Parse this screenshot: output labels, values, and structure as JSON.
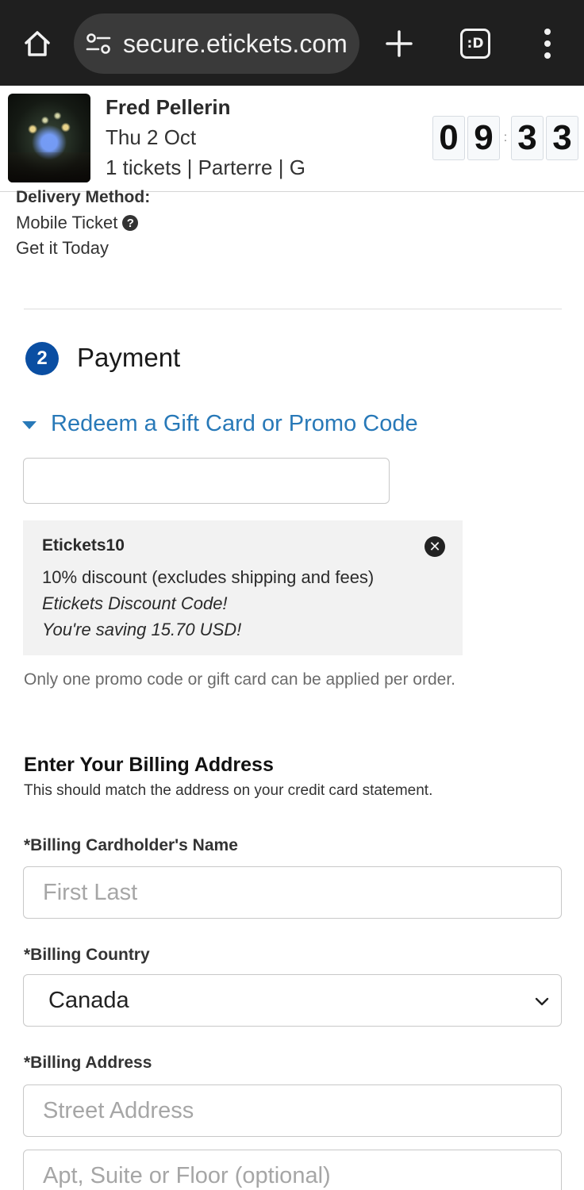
{
  "browser": {
    "url": "secure.etickets.com",
    "tab_count_label": ":D"
  },
  "event": {
    "name": "Fred Pellerin",
    "date": "Thu 2 Oct",
    "tickets": "1 tickets | Parterre | G",
    "timer": {
      "d1": "0",
      "d2": "9",
      "sep": ":",
      "d3": "3",
      "d4": "3"
    }
  },
  "delivery": {
    "heading": "Delivery Method:",
    "method": "Mobile Ticket",
    "timing": "Get it Today"
  },
  "payment": {
    "step_number": "2",
    "title": "Payment",
    "redeem_label": "Redeem a Gift Card or Promo Code",
    "promo_input_value": "",
    "applied_promo": {
      "code": "Etickets10",
      "description": "10% discount (excludes shipping and fees)",
      "note": "Etickets Discount Code!",
      "savings": "You're saving 15.70 USD!"
    },
    "limit_note": "Only one promo code or gift card can be applied per order."
  },
  "billing": {
    "heading": "Enter Your Billing Address",
    "subheading": "This should match the address on your credit card statement.",
    "name_label": "*Billing Cardholder's Name",
    "name_placeholder": "First Last",
    "country_label": "*Billing Country",
    "country_value": "Canada",
    "address_label": "*Billing Address",
    "street_placeholder": "Street Address",
    "apt_placeholder": "Apt, Suite or Floor (optional)"
  },
  "colors": {
    "link": "#2879b8",
    "step_badge": "#0a4ea2",
    "chrome_bg": "#1f1f1f"
  }
}
